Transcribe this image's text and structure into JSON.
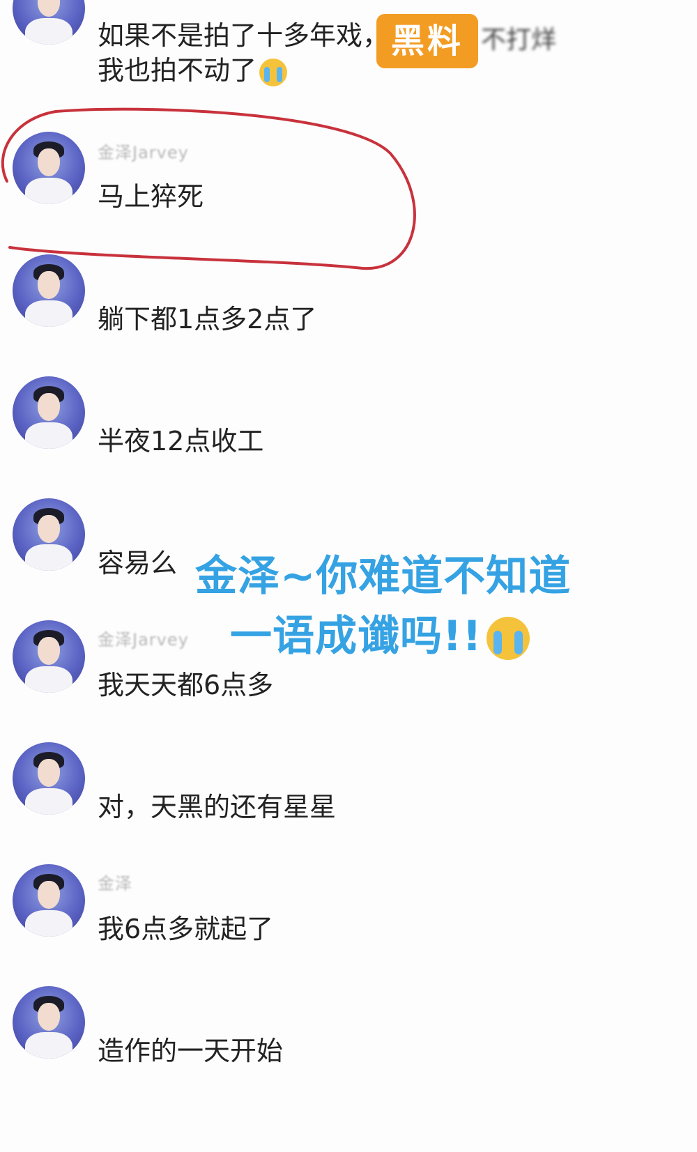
{
  "watermark": {
    "badge_label": "黑料",
    "tail_text": "不打烊"
  },
  "overlay_caption": {
    "line1": "金泽~你难道不知道",
    "line2": "一语成谶吗!!",
    "emoji": "loudly-crying-face"
  },
  "comments": [
    {
      "username": "",
      "text": "如果不是拍了十多年戏，",
      "text2": "我也拍不动了",
      "emoji": "loudly-crying-face"
    },
    {
      "username": "金泽Jarvey",
      "text": "马上猝死",
      "highlighted": true
    },
    {
      "username": "",
      "text": "躺下都1点多2点了"
    },
    {
      "username": "",
      "text": "半夜12点收工"
    },
    {
      "username": "",
      "text": "容易么"
    },
    {
      "username": "金泽Jarvey",
      "text": "我天天都6点多"
    },
    {
      "username": "",
      "text": "对，天黑的还有星星"
    },
    {
      "username": "金泽",
      "text": "我6点多就起了"
    },
    {
      "username": "",
      "text": "造作的一天开始"
    }
  ],
  "colors": {
    "highlight_circle": "#c8323c",
    "overlay_text": "#35a2e3",
    "badge": "#f39c24"
  }
}
